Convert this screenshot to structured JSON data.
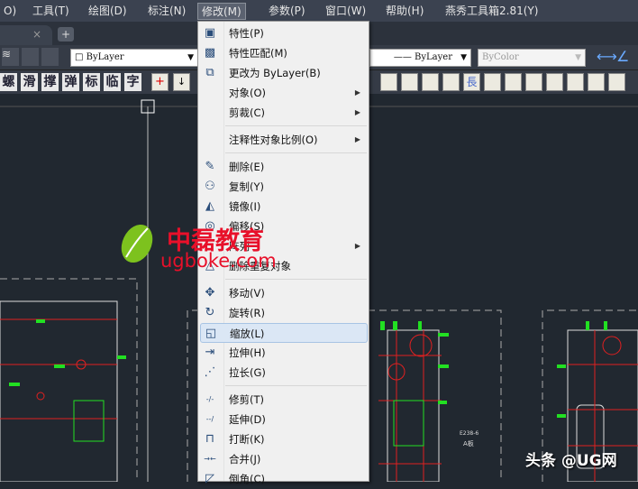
{
  "menubar": {
    "items": [
      "O)",
      "工具(T)",
      "绘图(D)",
      "标注(N)",
      "修改(M)",
      "参数(P)",
      "窗口(W)",
      "帮助(H)",
      "燕秀工具箱2.81(Y)"
    ],
    "active": "修改(M)"
  },
  "tabs": {
    "close": "×",
    "add": "+"
  },
  "toolbar": {
    "layer_combo": "□ ByLayer",
    "linetype_combo": "—— ByLayer",
    "color_combo": "ByColor",
    "arrow": "▼"
  },
  "toolbar2": {
    "chars": [
      "螺",
      "滑",
      "撑",
      "弹",
      "标",
      "临",
      "字"
    ],
    "long_char": "長"
  },
  "menu": {
    "items": [
      {
        "label": "特性(P)",
        "icon": "properties-icon"
      },
      {
        "label": "特性匹配(M)",
        "icon": "match-properties-icon"
      },
      {
        "label": "更改为 ByLayer(B)",
        "icon": "setbylayer-icon"
      },
      {
        "label": "对象(O)",
        "submenu": true
      },
      {
        "label": "剪裁(C)",
        "submenu": true
      },
      {
        "label": "注释性对象比例(O)",
        "submenu": true
      },
      {
        "label": "删除(E)",
        "icon": "erase-icon"
      },
      {
        "label": "复制(Y)",
        "icon": "copy-icon"
      },
      {
        "label": "镜像(I)",
        "icon": "mirror-icon"
      },
      {
        "label": "偏移(S)",
        "icon": "offset-icon"
      },
      {
        "label": "阵列",
        "submenu": true
      },
      {
        "label": "删除重复对象",
        "icon": "overkill-icon"
      },
      {
        "label": "移动(V)",
        "icon": "move-icon"
      },
      {
        "label": "旋转(R)",
        "icon": "rotate-icon"
      },
      {
        "label": "缩放(L)",
        "icon": "scale-icon",
        "highlighted": true
      },
      {
        "label": "拉伸(H)",
        "icon": "stretch-icon"
      },
      {
        "label": "拉长(G)",
        "icon": "lengthen-icon"
      },
      {
        "label": "修剪(T)",
        "icon": "trim-icon"
      },
      {
        "label": "延伸(D)",
        "icon": "extend-icon"
      },
      {
        "label": "打断(K)",
        "icon": "break-icon"
      },
      {
        "label": "合并(J)",
        "icon": "join-icon"
      },
      {
        "label": "倒角(C)",
        "icon": "chamfer-icon"
      }
    ],
    "submenu_arrow": "▶"
  },
  "drawing": {
    "label1": "E238-6",
    "label2": "A板"
  },
  "watermark": {
    "brand": "中磊教育",
    "url": "ugboke.com"
  },
  "credit": "头条 @UG网",
  "colors": {
    "canvas": "#212830",
    "cad_red": "#e02020",
    "cad_green": "#22e022",
    "menu_highlight": "#dbe7f5"
  }
}
